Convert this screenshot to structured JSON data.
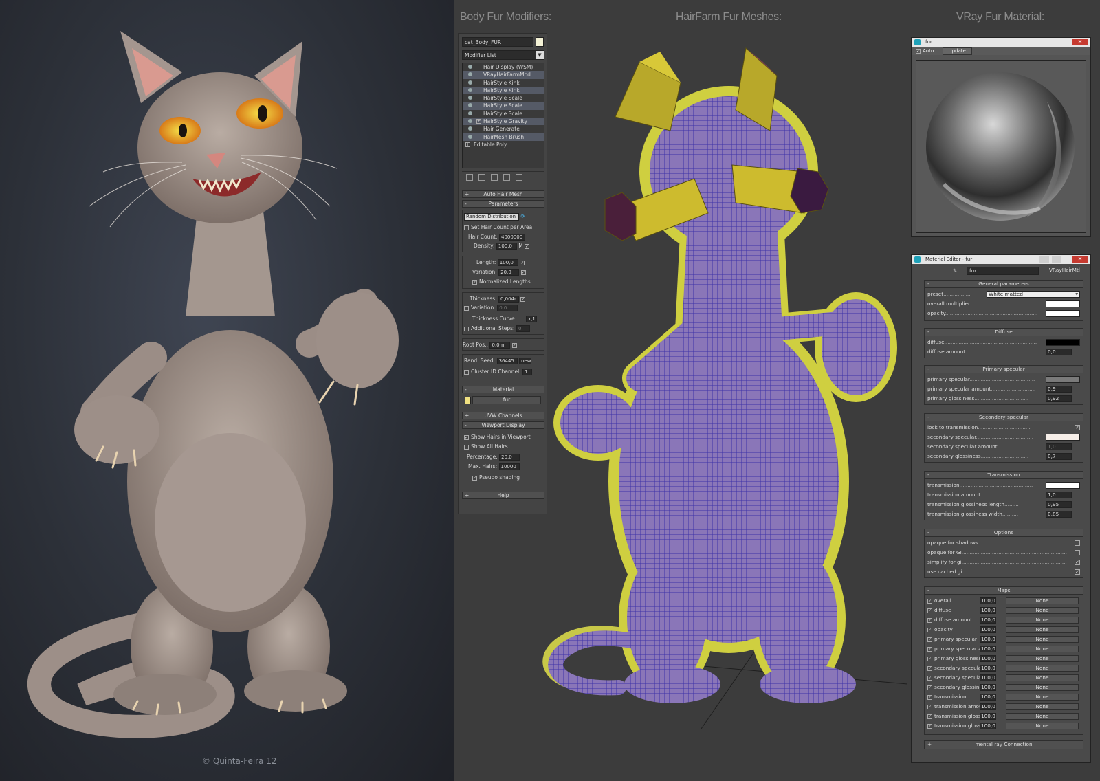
{
  "copyright": "© Quinta-Feira 12",
  "headings": {
    "modifiers": "Body Fur Modifiers:",
    "meshes": "HairFarm Fur Meshes:",
    "material": "VRay Fur Material:"
  },
  "modifier_panel": {
    "object_name": "cat_Body_FUR",
    "modifier_list": "Modifier List",
    "stack": [
      {
        "label": "Hair Display (WSM)",
        "plus": false
      },
      {
        "label": "VRayHairFarmMod",
        "plus": false
      },
      {
        "label": "HairStyle Kink",
        "plus": false
      },
      {
        "label": "HairStyle Kink",
        "plus": false
      },
      {
        "label": "HairStyle Scale",
        "plus": false
      },
      {
        "label": "HairStyle Scale",
        "plus": false
      },
      {
        "label": "HairStyle Scale",
        "plus": false
      },
      {
        "label": "HairStyle Gravity",
        "plus": true
      },
      {
        "label": "Hair Generate",
        "plus": false
      },
      {
        "label": "HairMesh Brush",
        "plus": false
      }
    ],
    "base_object": "Editable Poly",
    "rollouts": {
      "auto_hair_mesh": "Auto Hair Mesh",
      "parameters": "Parameters",
      "material": "Material",
      "uvw_channels": "UVW Channels",
      "viewport_display": "Viewport Display",
      "help": "Help"
    },
    "distribution": "Random Distribution",
    "set_hair_count": "Set Hair Count per Area",
    "hair_count_label": "Hair Count:",
    "hair_count": "4000000",
    "density_label": "Density:",
    "density": "100,0",
    "density_unit": "M",
    "length_label": "Length:",
    "length": "100,0",
    "variation_label": "Variation:",
    "variation": "20,0",
    "normalized_lengths": "Normalized Lengths",
    "thickness_label": "Thickness:",
    "thickness": "0,004r",
    "thick_variation_label": "Variation:",
    "thick_variation": "0,0",
    "thickness_curve": "Thickness Curve",
    "thickness_curve_btn": "x,1",
    "additional_steps": "Additional Steps:",
    "additional_steps_val": "0",
    "root_pos_label": "Root Pos.:",
    "root_pos": "0,0m",
    "rand_seed_label": "Rand. Seed:",
    "rand_seed": "36445",
    "new_label": "new",
    "cluster_label": "Cluster ID Channel:",
    "cluster_val": "1",
    "material_name": "fur",
    "show_hairs": "Show Hairs in Viewport",
    "show_all": "Show All Hairs",
    "percentage_label": "Percentage:",
    "percentage": "20,0",
    "max_hairs_label": "Max. Hairs:",
    "max_hairs": "10000",
    "pseudo_shading": "Pseudo shading"
  },
  "preview": {
    "title": "fur",
    "auto": "Auto",
    "update": "Update"
  },
  "material_editor": {
    "title": "Material Editor - fur",
    "material_name": "fur",
    "material_type": "VRayHairMtl",
    "general": {
      "title": "General parameters",
      "preset_label": "preset",
      "preset_value": "White matted",
      "overall_multiplier": "overall multiplier",
      "opacity": "opacity"
    },
    "diffuse": {
      "title": "Diffuse",
      "diffuse": "diffuse",
      "diffuse_amount": "diffuse amount",
      "diffuse_amount_val": "0,0"
    },
    "primary": {
      "title": "Primary specular",
      "primary_specular": "primary specular",
      "amount": "primary specular amount",
      "amount_val": "0,9",
      "glossiness": "primary glossiness",
      "glossiness_val": "0,92"
    },
    "secondary": {
      "title": "Secondary specular",
      "lock": "lock to transmission",
      "secondary_specular": "secondary specular",
      "amount": "secondary specular amount",
      "amount_val": "1,0",
      "glossiness": "secondary glossiness",
      "glossiness_val": "0,7"
    },
    "transmission": {
      "title": "Transmission",
      "transmission": "transmission",
      "amount": "transmission amount",
      "amount_val": "1,0",
      "gloss_length": "transmission glossiness length",
      "gloss_length_val": "0,95",
      "gloss_width": "transmission glossiness width",
      "gloss_width_val": "0,85"
    },
    "options": {
      "title": "Options",
      "items": [
        {
          "label": "opaque for shadows",
          "checked": false
        },
        {
          "label": "opaque for GI",
          "checked": false
        },
        {
          "label": "simplify for gi",
          "checked": true
        },
        {
          "label": "use cached gi",
          "checked": true
        }
      ]
    },
    "maps": {
      "title": "Maps",
      "rows": [
        {
          "label": "overall",
          "amount": "100,0",
          "map": "None"
        },
        {
          "label": "diffuse",
          "amount": "100,0",
          "map": "None"
        },
        {
          "label": "diffuse amount",
          "amount": "100,0",
          "map": "None"
        },
        {
          "label": "opacity",
          "amount": "100,0",
          "map": "None"
        },
        {
          "label": "primary specular",
          "amount": "100,0",
          "map": "None"
        },
        {
          "label": "primary specular ar",
          "amount": "100,0",
          "map": "None"
        },
        {
          "label": "primary glossiness",
          "amount": "100,0",
          "map": "None"
        },
        {
          "label": "secondary specula",
          "amount": "100,0",
          "map": "None"
        },
        {
          "label": "secondary specula",
          "amount": "100,0",
          "map": "None"
        },
        {
          "label": "secondary glossine",
          "amount": "100,0",
          "map": "None"
        },
        {
          "label": "transmission",
          "amount": "100,0",
          "map": "None"
        },
        {
          "label": "transmission amoun",
          "amount": "100,0",
          "map": "None"
        },
        {
          "label": "transmission glossi",
          "amount": "100,0",
          "map": "None"
        },
        {
          "label": "transmission glossi",
          "amount": "100,0",
          "map": "None"
        }
      ]
    },
    "mental_ray": "mental ray Connection"
  },
  "colors": {
    "fur_yellow": "#d8d84a",
    "mesh_purple": "#6a5aa8",
    "accent_cyan": "#1fa1b8"
  }
}
